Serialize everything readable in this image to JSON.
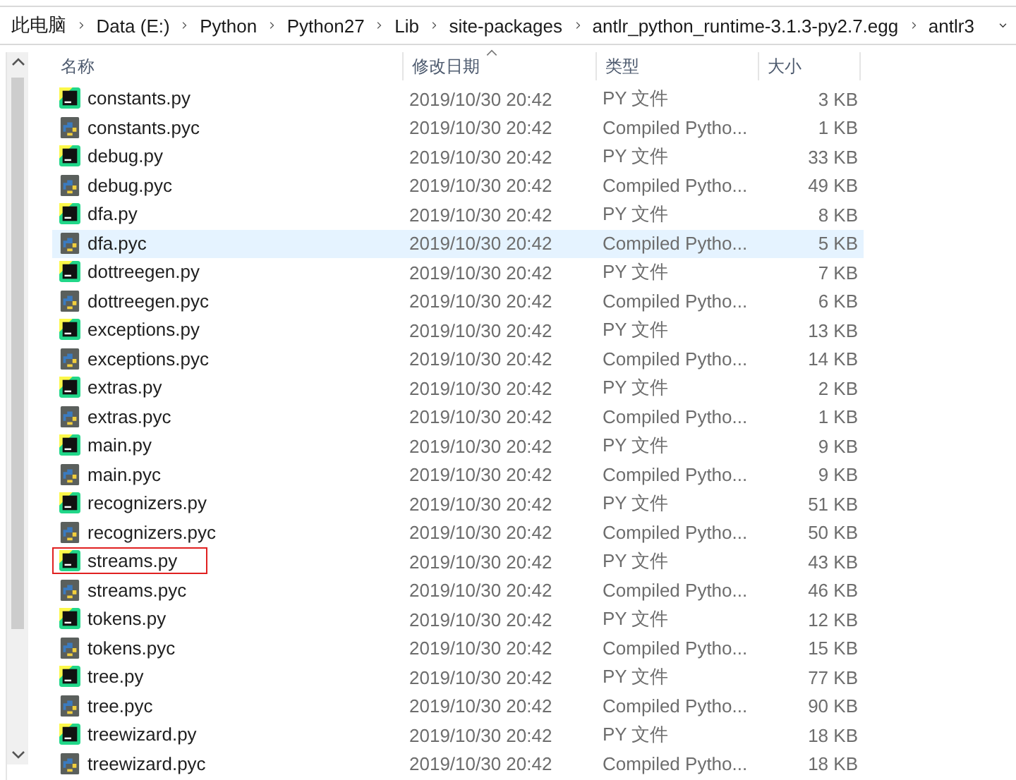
{
  "address_bar": {
    "crumbs": [
      "此电脑",
      "Data (E:)",
      "Python",
      "Python27",
      "Lib",
      "site-packages",
      "antlr_python_runtime-3.1.3-py2.7.egg",
      "antlr3"
    ]
  },
  "table": {
    "columns": [
      "名称",
      "修改日期",
      "类型",
      "大小"
    ],
    "rows": [
      {
        "name": "constants.py",
        "kind": "py",
        "modified": "2019/10/30 20:42",
        "type": "PY 文件",
        "size": "3 KB",
        "highlighted": false,
        "outlined": false
      },
      {
        "name": "constants.pyc",
        "kind": "pyc",
        "modified": "2019/10/30 20:42",
        "type": "Compiled Pytho...",
        "size": "1 KB",
        "highlighted": false,
        "outlined": false
      },
      {
        "name": "debug.py",
        "kind": "py",
        "modified": "2019/10/30 20:42",
        "type": "PY 文件",
        "size": "33 KB",
        "highlighted": false,
        "outlined": false
      },
      {
        "name": "debug.pyc",
        "kind": "pyc",
        "modified": "2019/10/30 20:42",
        "type": "Compiled Pytho...",
        "size": "49 KB",
        "highlighted": false,
        "outlined": false
      },
      {
        "name": "dfa.py",
        "kind": "py",
        "modified": "2019/10/30 20:42",
        "type": "PY 文件",
        "size": "8 KB",
        "highlighted": false,
        "outlined": false
      },
      {
        "name": "dfa.pyc",
        "kind": "pyc",
        "modified": "2019/10/30 20:42",
        "type": "Compiled Pytho...",
        "size": "5 KB",
        "highlighted": true,
        "outlined": false
      },
      {
        "name": "dottreegen.py",
        "kind": "py",
        "modified": "2019/10/30 20:42",
        "type": "PY 文件",
        "size": "7 KB",
        "highlighted": false,
        "outlined": false
      },
      {
        "name": "dottreegen.pyc",
        "kind": "pyc",
        "modified": "2019/10/30 20:42",
        "type": "Compiled Pytho...",
        "size": "6 KB",
        "highlighted": false,
        "outlined": false
      },
      {
        "name": "exceptions.py",
        "kind": "py",
        "modified": "2019/10/30 20:42",
        "type": "PY 文件",
        "size": "13 KB",
        "highlighted": false,
        "outlined": false
      },
      {
        "name": "exceptions.pyc",
        "kind": "pyc",
        "modified": "2019/10/30 20:42",
        "type": "Compiled Pytho...",
        "size": "14 KB",
        "highlighted": false,
        "outlined": false
      },
      {
        "name": "extras.py",
        "kind": "py",
        "modified": "2019/10/30 20:42",
        "type": "PY 文件",
        "size": "2 KB",
        "highlighted": false,
        "outlined": false
      },
      {
        "name": "extras.pyc",
        "kind": "pyc",
        "modified": "2019/10/30 20:42",
        "type": "Compiled Pytho...",
        "size": "1 KB",
        "highlighted": false,
        "outlined": false
      },
      {
        "name": "main.py",
        "kind": "py",
        "modified": "2019/10/30 20:42",
        "type": "PY 文件",
        "size": "9 KB",
        "highlighted": false,
        "outlined": false
      },
      {
        "name": "main.pyc",
        "kind": "pyc",
        "modified": "2019/10/30 20:42",
        "type": "Compiled Pytho...",
        "size": "9 KB",
        "highlighted": false,
        "outlined": false
      },
      {
        "name": "recognizers.py",
        "kind": "py",
        "modified": "2019/10/30 20:42",
        "type": "PY 文件",
        "size": "51 KB",
        "highlighted": false,
        "outlined": false
      },
      {
        "name": "recognizers.pyc",
        "kind": "pyc",
        "modified": "2019/10/30 20:42",
        "type": "Compiled Pytho...",
        "size": "50 KB",
        "highlighted": false,
        "outlined": false
      },
      {
        "name": "streams.py",
        "kind": "py",
        "modified": "2019/10/30 20:42",
        "type": "PY 文件",
        "size": "43 KB",
        "highlighted": false,
        "outlined": true
      },
      {
        "name": "streams.pyc",
        "kind": "pyc",
        "modified": "2019/10/30 20:42",
        "type": "Compiled Pytho...",
        "size": "46 KB",
        "highlighted": false,
        "outlined": false
      },
      {
        "name": "tokens.py",
        "kind": "py",
        "modified": "2019/10/30 20:42",
        "type": "PY 文件",
        "size": "12 KB",
        "highlighted": false,
        "outlined": false
      },
      {
        "name": "tokens.pyc",
        "kind": "pyc",
        "modified": "2019/10/30 20:42",
        "type": "Compiled Pytho...",
        "size": "15 KB",
        "highlighted": false,
        "outlined": false
      },
      {
        "name": "tree.py",
        "kind": "py",
        "modified": "2019/10/30 20:42",
        "type": "PY 文件",
        "size": "77 KB",
        "highlighted": false,
        "outlined": false
      },
      {
        "name": "tree.pyc",
        "kind": "pyc",
        "modified": "2019/10/30 20:42",
        "type": "Compiled Pytho...",
        "size": "90 KB",
        "highlighted": false,
        "outlined": false
      },
      {
        "name": "treewizard.py",
        "kind": "py",
        "modified": "2019/10/30 20:42",
        "type": "PY 文件",
        "size": "18 KB",
        "highlighted": false,
        "outlined": false
      },
      {
        "name": "treewizard.pyc",
        "kind": "pyc",
        "modified": "2019/10/30 20:42",
        "type": "Compiled Pytho...",
        "size": "18 KB",
        "highlighted": false,
        "outlined": false
      }
    ]
  }
}
